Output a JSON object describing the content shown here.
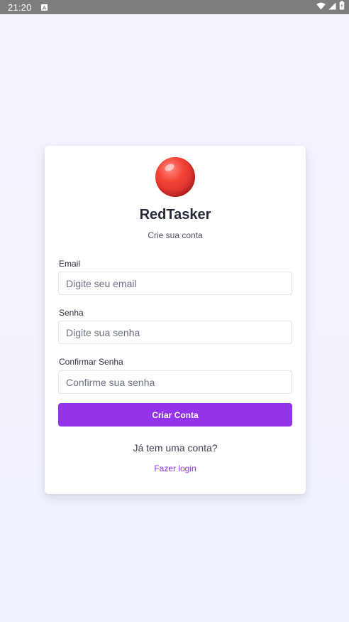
{
  "status_bar": {
    "time": "21:20",
    "icons": [
      "notification-a-icon",
      "wifi-icon",
      "signal-icon",
      "battery-icon"
    ]
  },
  "brand": {
    "logo_icon": "red-ball-icon",
    "title": "RedTasker",
    "subtitle": "Crie sua conta"
  },
  "form": {
    "email": {
      "label": "Email",
      "placeholder": "Digite seu email",
      "value": ""
    },
    "password": {
      "label": "Senha",
      "placeholder": "Digite sua senha",
      "value": ""
    },
    "confirm_password": {
      "label": "Confirmar Senha",
      "placeholder": "Confirme sua senha",
      "value": ""
    },
    "submit_label": "Criar Conta"
  },
  "footer": {
    "prompt": "Já tem uma conta?",
    "login_link": "Fazer login"
  },
  "colors": {
    "accent": "#9333ea",
    "logo_red": "#f44336",
    "status_bar": "#7d7d7d"
  }
}
